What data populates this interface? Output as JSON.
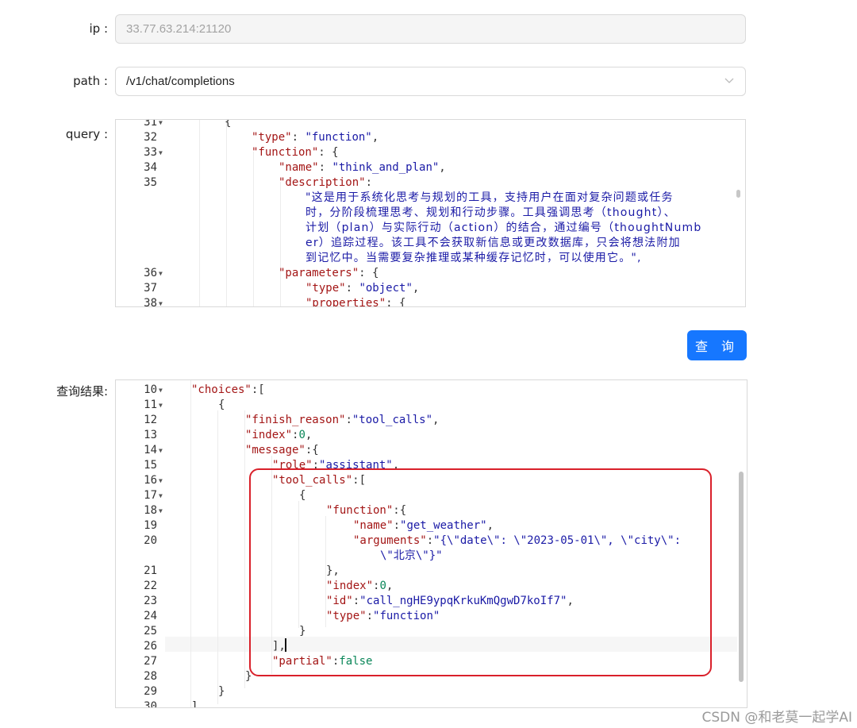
{
  "form": {
    "ip_label": "ip :",
    "ip_value": "33.77.63.214:21120",
    "path_label": "path :",
    "path_value": "/v1/chat/completions",
    "query_label": "query :",
    "result_label": "查询结果:",
    "query_button": "查 询"
  },
  "query_lines": [
    {
      "n": "31",
      "code": "{"
    },
    {
      "n": "32",
      "key": "\"type\"",
      "rest": ": ",
      "val": "\"function\"",
      "end": ","
    },
    {
      "n": "33",
      "key": "\"function\"",
      "rest": ": {"
    },
    {
      "n": "34",
      "key": "\"name\"",
      "rest": ": ",
      "val": "\"think_and_plan\"",
      "end": ","
    },
    {
      "n": "35",
      "key": "\"description\"",
      "rest": ":"
    },
    {
      "n": "36",
      "key": "\"parameters\"",
      "rest": ": {"
    },
    {
      "n": "37",
      "key": "\"type\"",
      "rest": ": ",
      "val": "\"object\"",
      "end": ","
    },
    {
      "n": "38",
      "key": "\"properties\"",
      "rest": ": {"
    }
  ],
  "query_description": [
    "\"这是用于系统化思考与规划的工具，支持用户在面对复杂问题或任务",
    "时，分阶段梳理思考、规划和行动步骤。工具强调思考（thought）、",
    "计划（plan）与实际行动（action）的结合，通过编号（thoughtNumb",
    "er）追踪过程。该工具不会获取新信息或更改数据库，只会将想法附加",
    "到记忆中。当需要复杂推理或某种缓存记忆时，可以使用它。\","
  ],
  "result_lines": [
    {
      "n": "10",
      "key": "\"choices\"",
      "rest": ":["
    },
    {
      "n": "11",
      "code": "{"
    },
    {
      "n": "12",
      "key": "\"finish_reason\"",
      "rest": ":",
      "val": "\"tool_calls\"",
      "end": ","
    },
    {
      "n": "13",
      "key": "\"index\"",
      "rest": ":",
      "num": "0",
      "end": ","
    },
    {
      "n": "14",
      "key": "\"message\"",
      "rest": ":{"
    },
    {
      "n": "15",
      "key": "\"role\"",
      "rest": ":",
      "val": "\"assistant\"",
      "end": ","
    },
    {
      "n": "16",
      "key": "\"tool_calls\"",
      "rest": ":["
    },
    {
      "n": "17",
      "code": "{"
    },
    {
      "n": "18",
      "key": "\"function\"",
      "rest": ":{"
    },
    {
      "n": "19",
      "key": "\"name\"",
      "rest": ":",
      "val": "\"get_weather\"",
      "end": ","
    },
    {
      "n": "20",
      "key": "\"arguments\"",
      "rest": ":",
      "val": "\"{\\\"date\\\": \\\"2023-05-01\\\", \\\"city\\\":"
    },
    {
      "n": "",
      "val": "\\\"北京\\\"}\""
    },
    {
      "n": "21",
      "code": "},"
    },
    {
      "n": "22",
      "key": "\"index\"",
      "rest": ":",
      "num": "0",
      "end": ","
    },
    {
      "n": "23",
      "key": "\"id\"",
      "rest": ":",
      "val": "\"call_ngHE9ypqKrkuKmQgwD7koIf7\"",
      "end": ","
    },
    {
      "n": "24",
      "key": "\"type\"",
      "rest": ":",
      "val": "\"function\""
    },
    {
      "n": "25",
      "code": "}"
    },
    {
      "n": "26",
      "code": "],"
    },
    {
      "n": "27",
      "key": "\"partial\"",
      "rest": ":",
      "num": "false"
    },
    {
      "n": "28",
      "code": "}"
    },
    {
      "n": "29",
      "code": "}"
    },
    {
      "n": "30",
      "code": "],"
    }
  ],
  "watermark": "CSDN @和老莫一起学AI",
  "colors": {
    "accent": "#1677ff",
    "highlight_box": "#d9202a",
    "json_key": "#a31515",
    "json_string": "#1a1aa6",
    "json_number": "#098658"
  }
}
